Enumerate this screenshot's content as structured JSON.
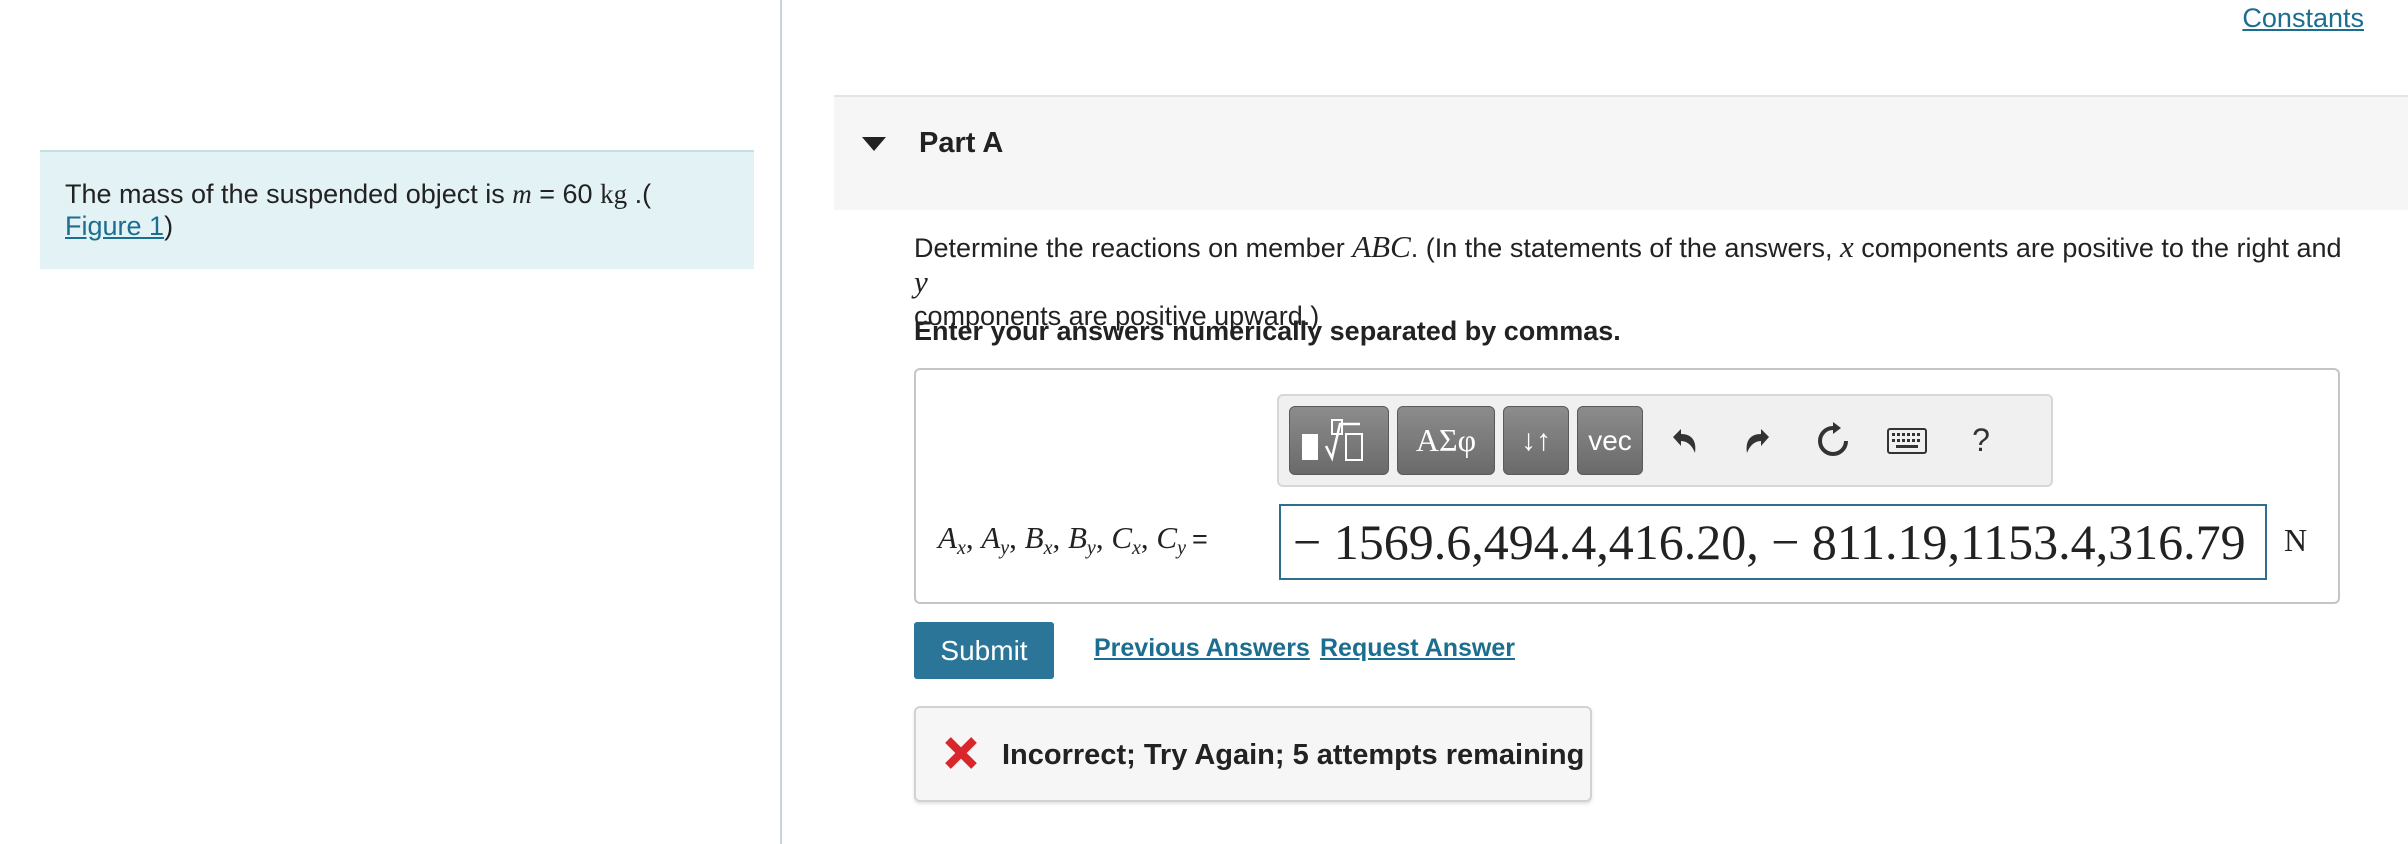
{
  "problem": {
    "text_before": "The mass of the suspended object is ",
    "mass_symbol": "m",
    "equals": " = 60 ",
    "unit": "kg",
    "text_after": " .(",
    "figure_link": "Figure 1",
    "close_paren": ")"
  },
  "header": {
    "constants_link": "Constants"
  },
  "part": {
    "title": "Part A"
  },
  "question": {
    "t1": "Determine the reactions on member ",
    "member": "ABC",
    "t2": ". (In the statements of the answers, ",
    "x": "x",
    "t3": " components are positive to the right and ",
    "y": "y",
    "t4": " components are positive upward.)",
    "instruction": "Enter your answers numerically separated by commas."
  },
  "toolbar": {
    "templates_icon": "templates-icon",
    "greek_label": "ΑΣφ",
    "arrows_label": "↓↑",
    "vec_label": "vec",
    "undo_icon": "undo-icon",
    "redo_icon": "redo-icon",
    "reset_icon": "reset-icon",
    "keyboard_icon": "keyboard-icon",
    "help_label": "?"
  },
  "answer": {
    "labels": [
      {
        "base": "A",
        "sub": "x"
      },
      {
        "base": "A",
        "sub": "y"
      },
      {
        "base": "B",
        "sub": "x"
      },
      {
        "base": "B",
        "sub": "y"
      },
      {
        "base": "C",
        "sub": "x"
      },
      {
        "base": "C",
        "sub": "y"
      }
    ],
    "equals_sign": "=",
    "value": "− 1569.6,494.4,416.20, − 811.19,1153.4,316.79",
    "unit": "N"
  },
  "actions": {
    "submit_label": "Submit",
    "previous_answers_label": "Previous Answers",
    "request_answer_label": "Request Answer"
  },
  "feedback": {
    "text": "Incorrect; Try Again; 5 attempts remaining",
    "icon": "close-x-icon",
    "icon_color": "#d8262b"
  },
  "colors": {
    "link": "#1b6e8f",
    "submit_bg": "#2b7599",
    "problem_bg": "#e3f2f5",
    "input_border": "#2e6f8e"
  }
}
